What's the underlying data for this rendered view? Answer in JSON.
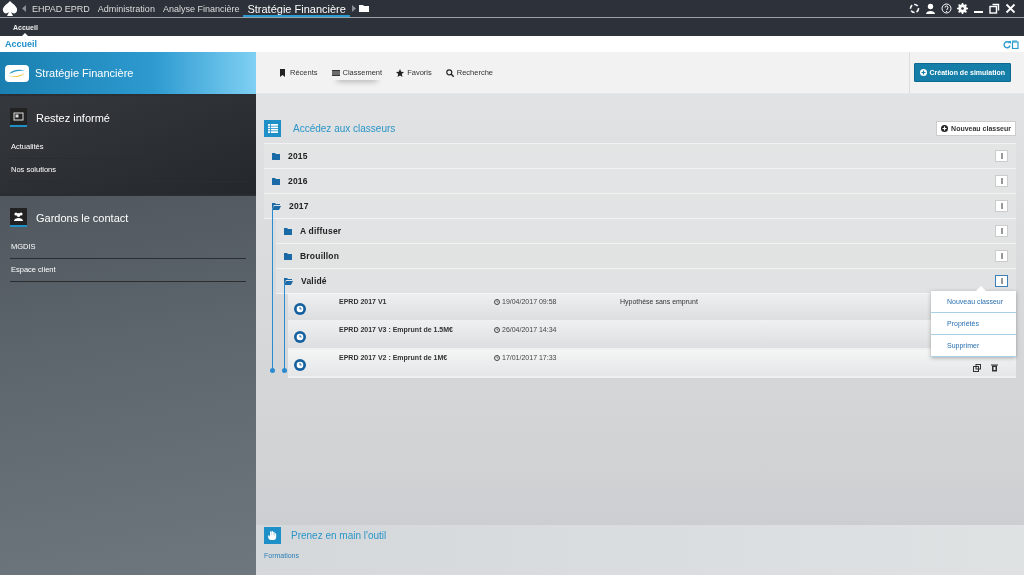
{
  "window": {
    "tabs": [
      {
        "label": "EHPAD EPRD",
        "selected": false
      },
      {
        "label": "Administration",
        "selected": false
      },
      {
        "label": "Analyse Financière",
        "selected": false
      },
      {
        "label": "Stratégie Financière",
        "selected": true
      }
    ]
  },
  "subtabs": [
    {
      "label": "Accueil",
      "selected": true
    }
  ],
  "breadcrumb": "Accueil",
  "sidebar": {
    "title": "Stratégie Financière",
    "sections": [
      {
        "kind": "news",
        "title": "Restez informé",
        "links": [
          "Actualités",
          "Nos solutions"
        ]
      },
      {
        "kind": "contact",
        "title": "Gardons le contact",
        "links": [
          "MGDIS",
          "Espace client"
        ]
      }
    ]
  },
  "toolbar": {
    "tabs": [
      {
        "kind": "recent",
        "label": "Récents",
        "selected": false
      },
      {
        "kind": "list",
        "label": "Classement",
        "selected": true
      },
      {
        "kind": "star",
        "label": "Favoris",
        "selected": false
      },
      {
        "kind": "search",
        "label": "Recherche",
        "selected": false
      }
    ],
    "action": "Création de simulation"
  },
  "classeurs": {
    "title": "Accédez aux classeurs",
    "new_button": "Nouveau classeur",
    "items": [
      {
        "kind": "folder",
        "label": "2015",
        "expanded": false,
        "menu_open": false
      },
      {
        "kind": "folder",
        "label": "2016",
        "expanded": false,
        "menu_open": false
      },
      {
        "kind": "folder",
        "label": "2017",
        "expanded": true,
        "menu_open": false,
        "children": [
          {
            "kind": "folder",
            "label": "A diffuser",
            "expanded": false,
            "menu_open": false
          },
          {
            "kind": "folder",
            "label": "Brouillon",
            "expanded": false,
            "menu_open": false
          },
          {
            "kind": "folder",
            "label": "Validé",
            "expanded": true,
            "menu_open": true,
            "children": [
              {
                "kind": "document",
                "name": "EPRD 2017 V1",
                "date": "19/04/2017 09:58",
                "note": "Hypothèse sans emprunt",
                "hovered": false
              },
              {
                "kind": "document",
                "name": "EPRD 2017 V3 : Emprunt de 1.5M€",
                "date": "26/04/2017 14:34",
                "hovered": false
              },
              {
                "kind": "document",
                "name": "EPRD 2017 V2 : Emprunt de 1M€",
                "date": "17/01/2017 17:33",
                "hovered": true
              }
            ]
          }
        ]
      }
    ]
  },
  "context_menu": [
    "Nouveau classeur",
    "Propriétés",
    "Supprimer"
  ],
  "help": {
    "title": "Prenez en main l'outil",
    "links": [
      "Formations"
    ]
  }
}
